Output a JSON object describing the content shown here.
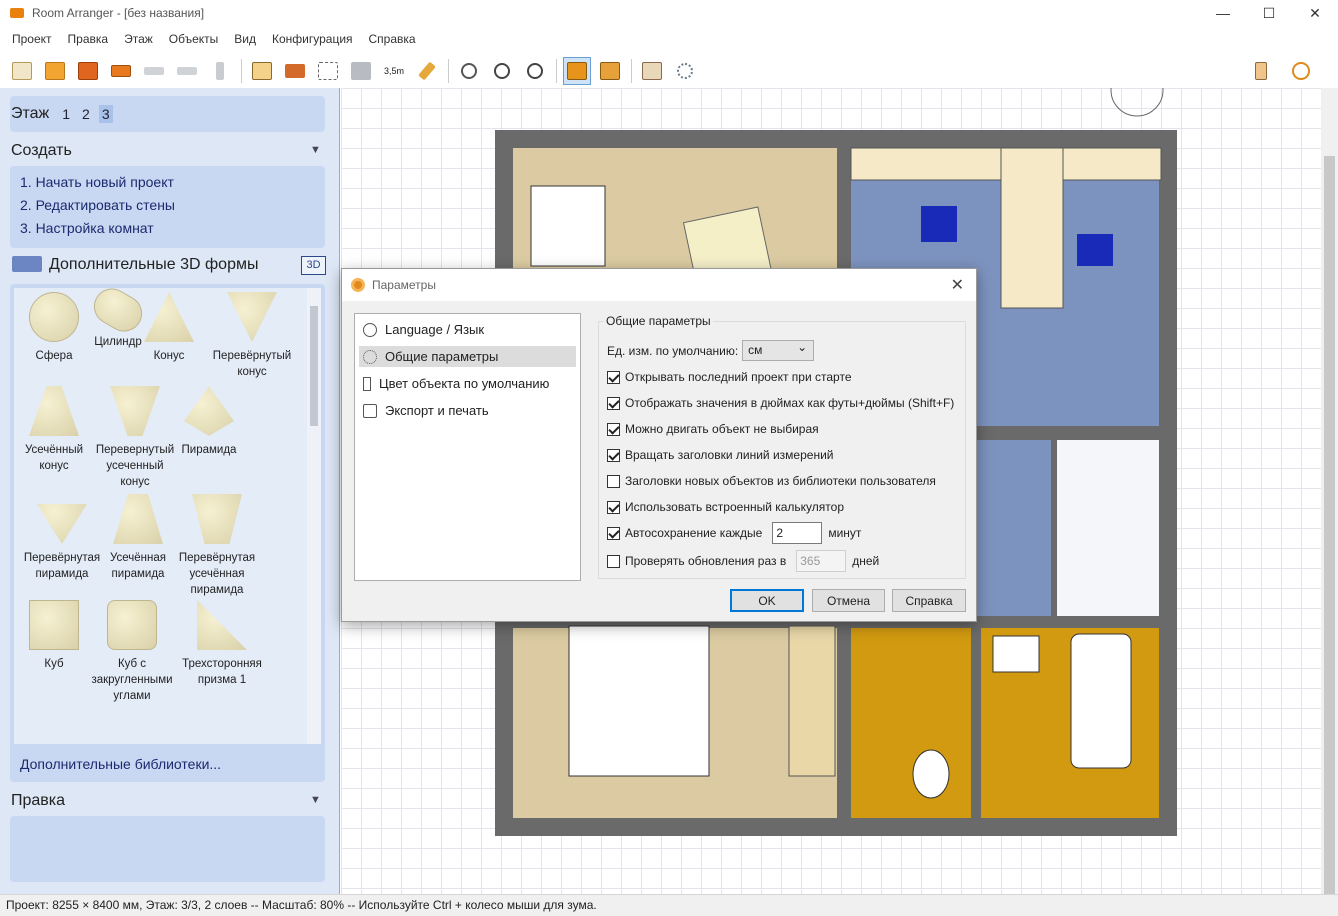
{
  "window": {
    "title": "Room Arranger - [без названия]",
    "min": "—",
    "max": "☐",
    "close": "✕"
  },
  "menu": [
    "Проект",
    "Правка",
    "Этаж",
    "Объекты",
    "Вид",
    "Конфигурация",
    "Справка"
  ],
  "toolbar": {
    "icons": [
      "new-project-icon",
      "open-icon",
      "save-icon",
      "print-icon",
      "undo-icon",
      "redo-icon",
      "brush-icon",
      "floorplan-icon",
      "wall-icon",
      "select-icon",
      "3d-objects-icon",
      "measure-icon",
      "pencil-icon",
      "zoom-fit-icon",
      "zoom-in-icon",
      "zoom-out-icon",
      "object-mode-icon",
      "library-icon",
      "house-3d-icon",
      "settings-burst-icon",
      "hand-icon",
      "info-icon"
    ],
    "measure_label": "3,5m"
  },
  "left": {
    "floor_label": "Этаж",
    "floors": [
      "1",
      "2",
      "3"
    ],
    "selected_floor": "3",
    "create_title": "Создать",
    "create_items": [
      "1. Начать новый проект",
      "2. Редактировать стены",
      "3. Настройка комнат"
    ],
    "shapes_title": "Дополнительные 3D формы",
    "shapes_badge": "3D",
    "shapes": [
      "Сфера",
      "Цилиндр",
      "Конус",
      "Перевёрнутый конус",
      "Усечённый конус",
      "Перевернутый усеченный конус",
      "Пирамида",
      "Перевёрнутая пирамида",
      "Усечённая пирамида",
      "Перевёрнутая усечённая пирамида",
      "Куб",
      "Куб с закругленными углами",
      "Трехсторонняя призма 1"
    ],
    "more_libraries": "Дополнительные библиотеки...",
    "edit_title": "Правка"
  },
  "dialog": {
    "title": "Параметры",
    "close": "✕",
    "nav": [
      "Language / Язык",
      "Общие параметры",
      "Цвет объекта по умолчанию",
      "Экспорт и печать"
    ],
    "nav_selected": "Общие параметры",
    "group_title": "Общие параметры",
    "unit_label": "Ед. изм. по умолчанию:",
    "unit_value": "см",
    "options": [
      {
        "label": "Открывать последний проект при старте",
        "checked": true
      },
      {
        "label": "Отображать значения в дюймах как футы+дюймы (Shift+F)",
        "checked": true
      },
      {
        "label": "Можно двигать объект не выбирая",
        "checked": true
      },
      {
        "label": "Вращать заголовки линий измерений",
        "checked": true
      },
      {
        "label": "Заголовки новых объектов из библиотеки пользователя",
        "checked": false
      },
      {
        "label": "Использовать встроенный калькулятор",
        "checked": true
      }
    ],
    "autosave_label": "Автосохранение каждые",
    "autosave_value": "2",
    "autosave_unit": "минут",
    "update_label": "Проверять обновления раз в",
    "update_value": "365",
    "update_unit": "дней",
    "ok": "OK",
    "cancel": "Отмена",
    "help": "Справка"
  },
  "status": "Проект: 8255 × 8400 мм, Этаж: 3/3, 2 слоев -- Масштаб: 80% -- Используйте Ctrl + колесо мыши для зума.",
  "colors": {
    "accent": "#0078d7",
    "panel": "#dde7f6",
    "wall": "#666666",
    "carpet": "#7791bd",
    "tile": "#d19a10",
    "wood": "#d8c8a0"
  }
}
